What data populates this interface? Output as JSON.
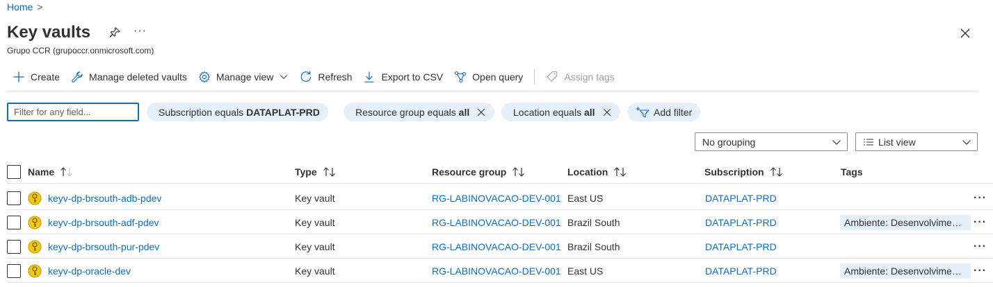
{
  "breadcrumb": {
    "home": "Home",
    "separator": ">"
  },
  "header": {
    "title": "Key vaults",
    "more": "···",
    "subtitle": "Grupo CCR (grupoccr.onmicrosoft.com)"
  },
  "toolbar": {
    "create": "Create",
    "manage_deleted": "Manage deleted vaults",
    "manage_view": "Manage view",
    "refresh": "Refresh",
    "export_csv": "Export to CSV",
    "open_query": "Open query",
    "assign_tags": "Assign tags"
  },
  "filters": {
    "search_placeholder": "Filter for any field...",
    "subscription": {
      "prefix": "Subscription equals",
      "value": "DATAPLAT-PRD"
    },
    "resource_group": {
      "prefix": "Resource group equals",
      "value": "all"
    },
    "location": {
      "prefix": "Location equals",
      "value": "all"
    },
    "add_filter": "Add filter"
  },
  "view_controls": {
    "grouping": "No grouping",
    "view": "List view"
  },
  "table": {
    "columns": {
      "name": "Name",
      "type": "Type",
      "resource_group": "Resource group",
      "location": "Location",
      "subscription": "Subscription",
      "tags": "Tags"
    },
    "rows": [
      {
        "name": "keyv-dp-brsouth-adb-pdev",
        "type": "Key vault",
        "resource_group": "RG-LABINOVACAO-DEV-001",
        "location": "East US",
        "subscription": "DATAPLAT-PRD",
        "tags": ""
      },
      {
        "name": "keyv-dp-brsouth-adf-pdev",
        "type": "Key vault",
        "resource_group": "RG-LABINOVACAO-DEV-001",
        "location": "Brazil South",
        "subscription": "DATAPLAT-PRD",
        "tags": "Ambiente: Desenvolviment..."
      },
      {
        "name": "keyv-dp-brsouth-pur-pdev",
        "type": "Key vault",
        "resource_group": "RG-LABINOVACAO-DEV-001",
        "location": "Brazil South",
        "subscription": "DATAPLAT-PRD",
        "tags": ""
      },
      {
        "name": "keyv-dp-oracle-dev",
        "type": "Key vault",
        "resource_group": "RG-LABINOVACAO-DEV-001",
        "location": "East US",
        "subscription": "DATAPLAT-PRD",
        "tags": "Ambiente: Desenvolviment..."
      }
    ],
    "row_more": "···"
  },
  "colors": {
    "link": "#0f6cbd",
    "pill_bg": "#e6f0fa",
    "text": "#323130",
    "disabled": "#a19f9d",
    "keyvault_icon": "#f2c811"
  }
}
